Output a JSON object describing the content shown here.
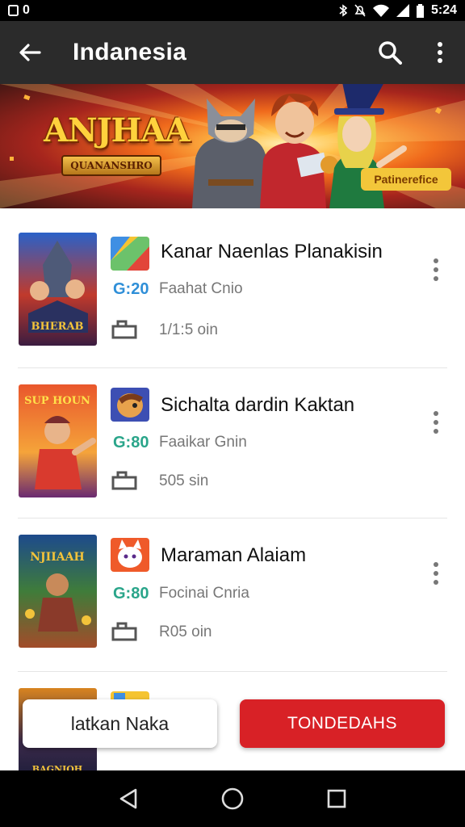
{
  "status_bar": {
    "left_label": "0",
    "time": "5:24"
  },
  "app_bar": {
    "title": "Indanesia"
  },
  "banner": {
    "logo_title": "ANJHAA",
    "logo_subtitle": "QUANANSHRO",
    "badge": "Patinerefice"
  },
  "items": [
    {
      "title": "Kanar Naenlas Planakisin",
      "price": "G:20",
      "subtitle": "Faahat Cnio",
      "size": "1/1:5 oin",
      "price_color": "#2f8fd8"
    },
    {
      "title": "Sichalta dardin Kaktan",
      "price": "G:80",
      "subtitle": "Faaikar Gnin",
      "size": "505 sin",
      "price_color": "#2aa58a"
    },
    {
      "title": "Maraman Alaiam",
      "price": "G:80",
      "subtitle": "Focinai Cnria",
      "size": "R05 oin",
      "price_color": "#2aa58a"
    }
  ],
  "buttons": {
    "secondary": "latkan Naka",
    "primary": "TONDEDAHS"
  },
  "colors": {
    "app_bar": "#2b2b2b",
    "accent_red": "#d82126"
  }
}
